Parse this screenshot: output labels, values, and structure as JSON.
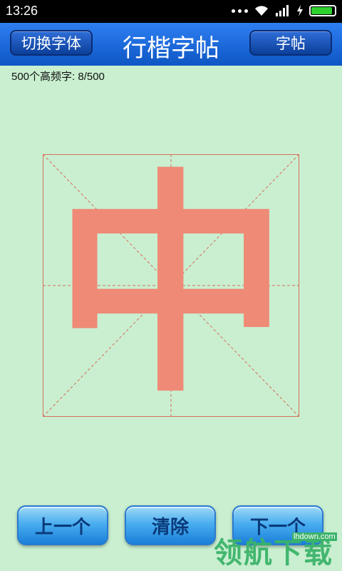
{
  "status_bar": {
    "time": "13:26",
    "battery_level": 0.9
  },
  "header": {
    "left_button": "切换字体",
    "title": "行楷字帖",
    "right_button": "字帖"
  },
  "counter": "500个高频字: 8/500",
  "practice": {
    "character": "中",
    "character_color": "#ee8a76",
    "grid_color": "#d96d5d"
  },
  "buttons": {
    "prev": "上一个",
    "clear": "清除",
    "next": "下一个"
  },
  "watermark": {
    "text": "领航下载",
    "url": "lhdown.com"
  }
}
